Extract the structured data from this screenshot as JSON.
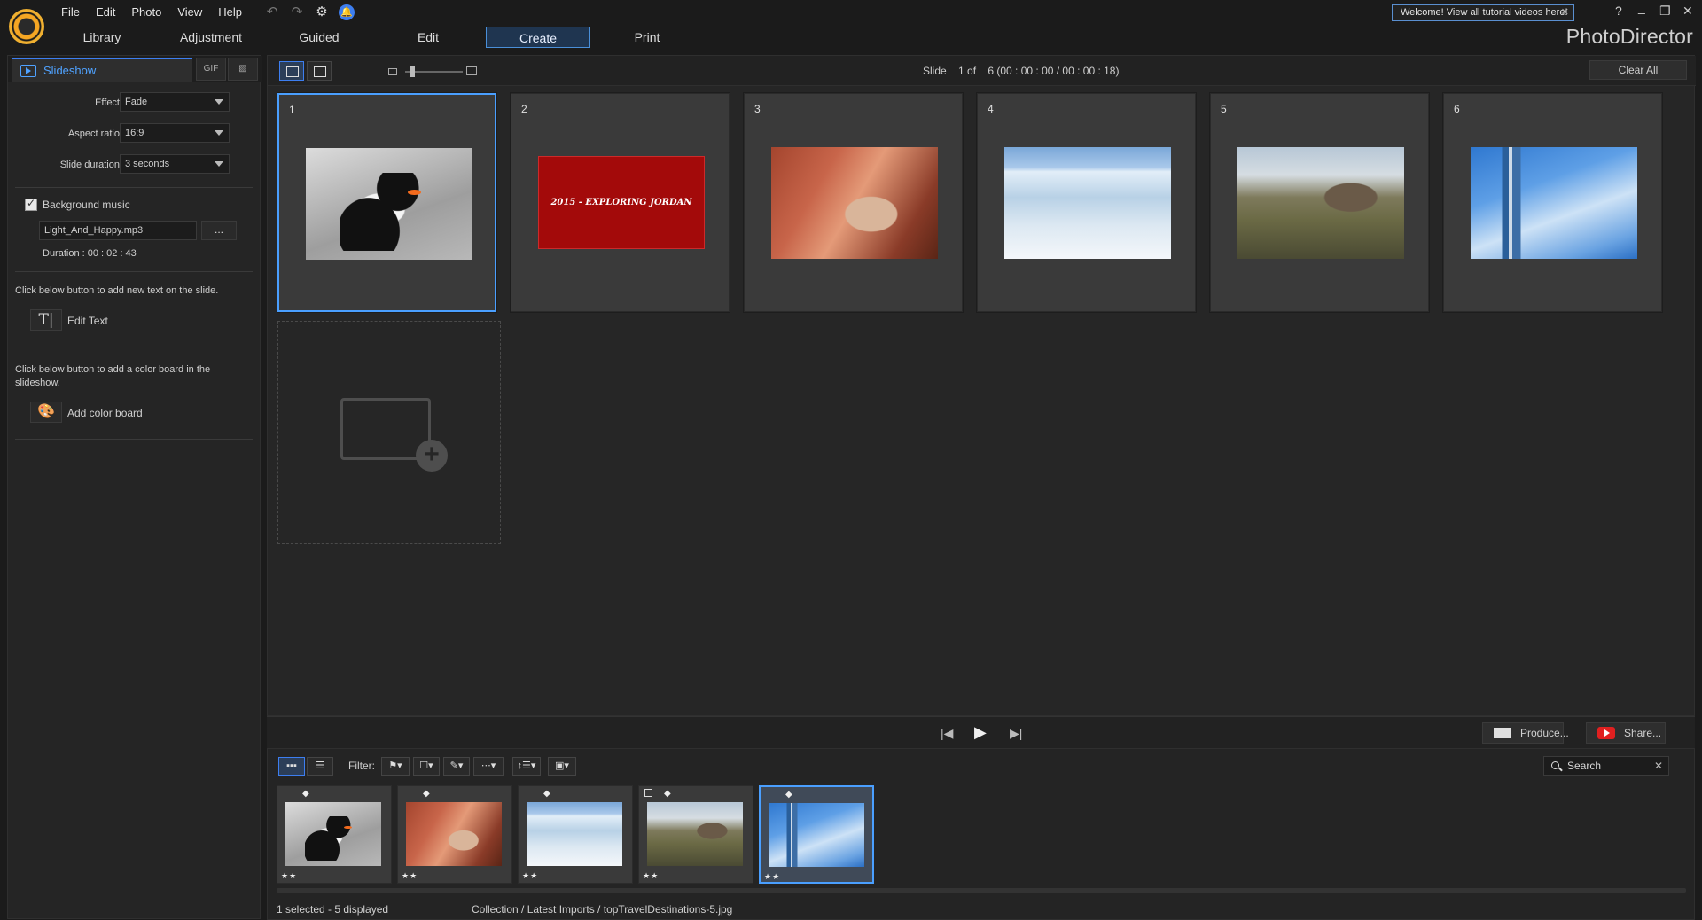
{
  "menu": [
    "File",
    "Edit",
    "Photo",
    "View",
    "Help"
  ],
  "quick_icons": [
    "undo-icon",
    "redo-icon",
    "settings-icon",
    "notification-bell-icon"
  ],
  "welcome": "Welcome! View all tutorial videos here!",
  "window_controls": [
    "?",
    "_",
    "❐",
    "✕"
  ],
  "tabs": [
    "Library",
    "Adjustment",
    "Guided",
    "Edit",
    "Create",
    "Print"
  ],
  "active_tab": "Create",
  "app_name": "PhotoDirector",
  "left": {
    "tab_label": "Slideshow",
    "tab_icons": [
      "gif-icon",
      "image-export-icon"
    ],
    "effect_label": "Effect",
    "effect_value": "Fade",
    "aspect_label": "Aspect ratio",
    "aspect_value": "16:9",
    "duration_label": "Slide duration",
    "duration_value": "3 seconds",
    "music_label": "Background music",
    "music_checked": true,
    "music_file": "Light_And_Happy.mp3",
    "browse_label": "...",
    "music_duration": "Duration : 00 : 02 : 43",
    "text_hint": "Click below button to add new text on the slide.",
    "edit_text_label": "Edit Text",
    "color_hint_1": "Click below button to add a color board in the",
    "color_hint_2": "slideshow.",
    "color_board_label": "Add color board"
  },
  "main": {
    "slide_info": "Slide    1 of    6 (00 : 00 : 00 / 00 : 00 : 18)",
    "clear_all": "Clear All",
    "slides": [
      {
        "num": "1",
        "image": "penguin"
      },
      {
        "num": "2",
        "image": "title-card",
        "text": "2015 - EXPLORING JORDAN"
      },
      {
        "num": "3",
        "image": "camel"
      },
      {
        "num": "4",
        "image": "glacier"
      },
      {
        "num": "5",
        "image": "rock-landscape"
      },
      {
        "num": "6",
        "image": "tower"
      }
    ],
    "selected_slide": 1
  },
  "playback": {
    "produce_label": "Produce...",
    "share_label": "Share..."
  },
  "browser": {
    "filter_label": "Filter:",
    "search_label": "Search",
    "thumbs": [
      {
        "image": "penguin",
        "stars": "★★"
      },
      {
        "image": "camel",
        "stars": "★★"
      },
      {
        "image": "glacier",
        "stars": "★★"
      },
      {
        "image": "rock-landscape",
        "stars": "★★"
      },
      {
        "image": "tower",
        "stars": "★★"
      }
    ],
    "status_left": "1 selected - 5 displayed",
    "status_path": "Collection / Latest Imports / topTravelDestinations-5.jpg"
  },
  "colors": {
    "accent": "#3d7ef0",
    "selection": "#4a9fff",
    "background": "#1b1b1b",
    "panel": "#262626"
  }
}
